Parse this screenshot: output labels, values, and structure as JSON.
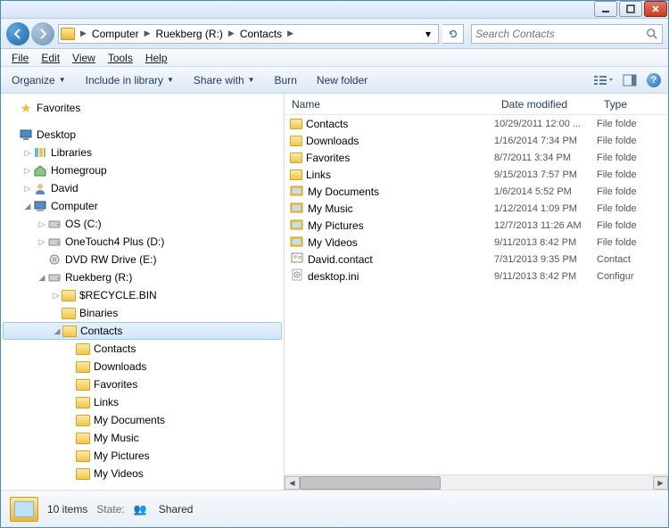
{
  "titlebar": {},
  "breadcrumbs": [
    "Computer",
    "Ruekberg (R:)",
    "Contacts"
  ],
  "search": {
    "placeholder": "Search Contacts"
  },
  "menu": [
    "File",
    "Edit",
    "View",
    "Tools",
    "Help"
  ],
  "toolbar": {
    "organize": "Organize",
    "include": "Include in library",
    "share": "Share with",
    "burn": "Burn",
    "newfolder": "New folder"
  },
  "tree": [
    {
      "indent": 0,
      "label": "Favorites",
      "icon": "star",
      "expander": ""
    },
    {
      "spacer": true
    },
    {
      "indent": 0,
      "label": "Desktop",
      "icon": "desktop",
      "expander": ""
    },
    {
      "indent": 1,
      "label": "Libraries",
      "icon": "lib",
      "expander": "▷"
    },
    {
      "indent": 1,
      "label": "Homegroup",
      "icon": "home",
      "expander": "▷"
    },
    {
      "indent": 1,
      "label": "David",
      "icon": "user",
      "expander": "▷"
    },
    {
      "indent": 1,
      "label": "Computer",
      "icon": "computer",
      "expander": "◢"
    },
    {
      "indent": 2,
      "label": "OS (C:)",
      "icon": "drive",
      "expander": "▷"
    },
    {
      "indent": 2,
      "label": "OneTouch4 Plus (D:)",
      "icon": "drive",
      "expander": "▷"
    },
    {
      "indent": 2,
      "label": "DVD RW Drive (E:)",
      "icon": "dvd",
      "expander": ""
    },
    {
      "indent": 2,
      "label": "Ruekberg (R:)",
      "icon": "drive",
      "expander": "◢"
    },
    {
      "indent": 3,
      "label": "$RECYCLE.BIN",
      "icon": "folder",
      "expander": "▷"
    },
    {
      "indent": 3,
      "label": "Binaries",
      "icon": "folder",
      "expander": ""
    },
    {
      "indent": 3,
      "label": "Contacts",
      "icon": "folder",
      "expander": "◢",
      "selected": true
    },
    {
      "indent": 4,
      "label": "Contacts",
      "icon": "folder",
      "expander": ""
    },
    {
      "indent": 4,
      "label": "Downloads",
      "icon": "folder",
      "expander": ""
    },
    {
      "indent": 4,
      "label": "Favorites",
      "icon": "folder",
      "expander": ""
    },
    {
      "indent": 4,
      "label": "Links",
      "icon": "folder",
      "expander": ""
    },
    {
      "indent": 4,
      "label": "My Documents",
      "icon": "folder",
      "expander": ""
    },
    {
      "indent": 4,
      "label": "My Music",
      "icon": "folder",
      "expander": ""
    },
    {
      "indent": 4,
      "label": "My Pictures",
      "icon": "folder",
      "expander": ""
    },
    {
      "indent": 4,
      "label": "My Videos",
      "icon": "folder",
      "expander": ""
    }
  ],
  "columns": {
    "name": "Name",
    "date": "Date modified",
    "type": "Type"
  },
  "files": [
    {
      "name": "Contacts",
      "date": "10/29/2011 12:00 ...",
      "type": "File folde",
      "icon": "folder"
    },
    {
      "name": "Downloads",
      "date": "1/16/2014 7:34 PM",
      "type": "File folde",
      "icon": "folder"
    },
    {
      "name": "Favorites",
      "date": "8/7/2011 3:34 PM",
      "type": "File folde",
      "icon": "folder"
    },
    {
      "name": "Links",
      "date": "9/15/2013 7:57 PM",
      "type": "File folde",
      "icon": "folder"
    },
    {
      "name": "My Documents",
      "date": "1/6/2014 5:52 PM",
      "type": "File folde",
      "icon": "libfolder"
    },
    {
      "name": "My Music",
      "date": "1/12/2014 1:09 PM",
      "type": "File folde",
      "icon": "libfolder"
    },
    {
      "name": "My Pictures",
      "date": "12/7/2013 11:26 AM",
      "type": "File folde",
      "icon": "libfolder"
    },
    {
      "name": "My Videos",
      "date": "9/11/2013 8:42 PM",
      "type": "File folde",
      "icon": "libfolder"
    },
    {
      "name": "David.contact",
      "date": "7/31/2013 9:35 PM",
      "type": "Contact",
      "icon": "contact"
    },
    {
      "name": "desktop.ini",
      "date": "9/11/2013 8:42 PM",
      "type": "Configur",
      "icon": "ini"
    }
  ],
  "status": {
    "count": "10 items",
    "state_label": "State:",
    "state_value": "Shared"
  }
}
